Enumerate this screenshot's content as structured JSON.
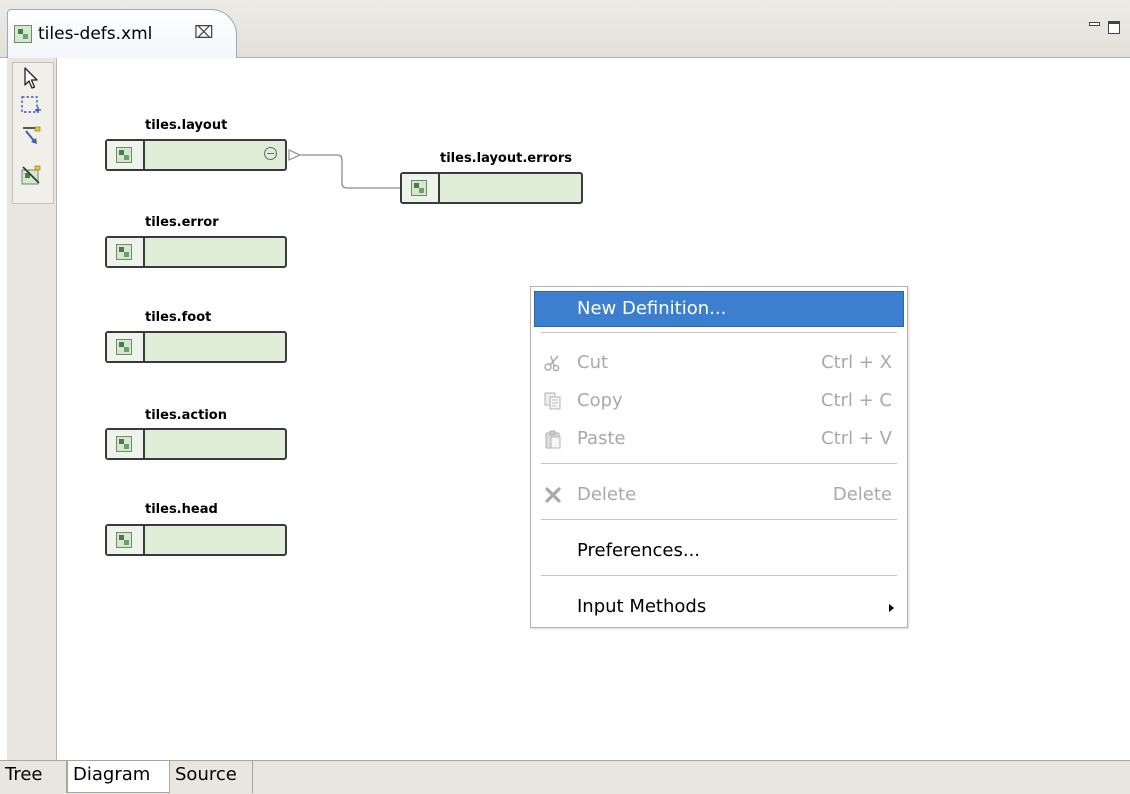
{
  "editor": {
    "tab_title": "tiles-defs.xml",
    "tab_close": "⌧",
    "window_controls": [
      "minimize-icon",
      "maximize-icon"
    ]
  },
  "palette": {
    "tools": [
      "select-arrow-icon",
      "marquee-select-icon",
      "connection-tool-icon",
      "add-definition-icon"
    ]
  },
  "diagram": {
    "nodes": [
      {
        "label": "tiles.layout",
        "collapsible": true
      },
      {
        "label": "tiles.layout.errors",
        "collapsible": false
      },
      {
        "label": "tiles.error",
        "collapsible": false
      },
      {
        "label": "tiles.foot",
        "collapsible": false
      },
      {
        "label": "tiles.action",
        "collapsible": false
      },
      {
        "label": "tiles.head",
        "collapsible": false
      }
    ],
    "connections": [
      {
        "from": "tiles.layout.errors",
        "to": "tiles.layout"
      }
    ]
  },
  "context_menu": {
    "items": [
      {
        "label": "New Definition...",
        "accel": "",
        "icon": "",
        "enabled": true,
        "highlighted": true
      },
      {
        "label": "Cut",
        "accel": "Ctrl + X",
        "icon": "cut-icon",
        "enabled": false
      },
      {
        "label": "Copy",
        "accel": "Ctrl + C",
        "icon": "copy-icon",
        "enabled": false
      },
      {
        "label": "Paste",
        "accel": "Ctrl + V",
        "icon": "paste-icon",
        "enabled": false
      },
      {
        "label": "Delete",
        "accel": "Delete",
        "icon": "delete-icon",
        "enabled": false
      },
      {
        "label": "Preferences...",
        "accel": "",
        "icon": "",
        "enabled": true
      },
      {
        "label": "Input Methods",
        "accel": "",
        "icon": "",
        "enabled": true,
        "submenu": true
      }
    ]
  },
  "bottom_tabs": [
    {
      "label": "Tree",
      "active": false
    },
    {
      "label": "Diagram",
      "active": true
    },
    {
      "label": "Source",
      "active": false
    }
  ],
  "colors": {
    "node_fill": "#e0eed9",
    "menu_highlight": "#3d7fcf",
    "disabled_text": "#a9a9a9"
  }
}
